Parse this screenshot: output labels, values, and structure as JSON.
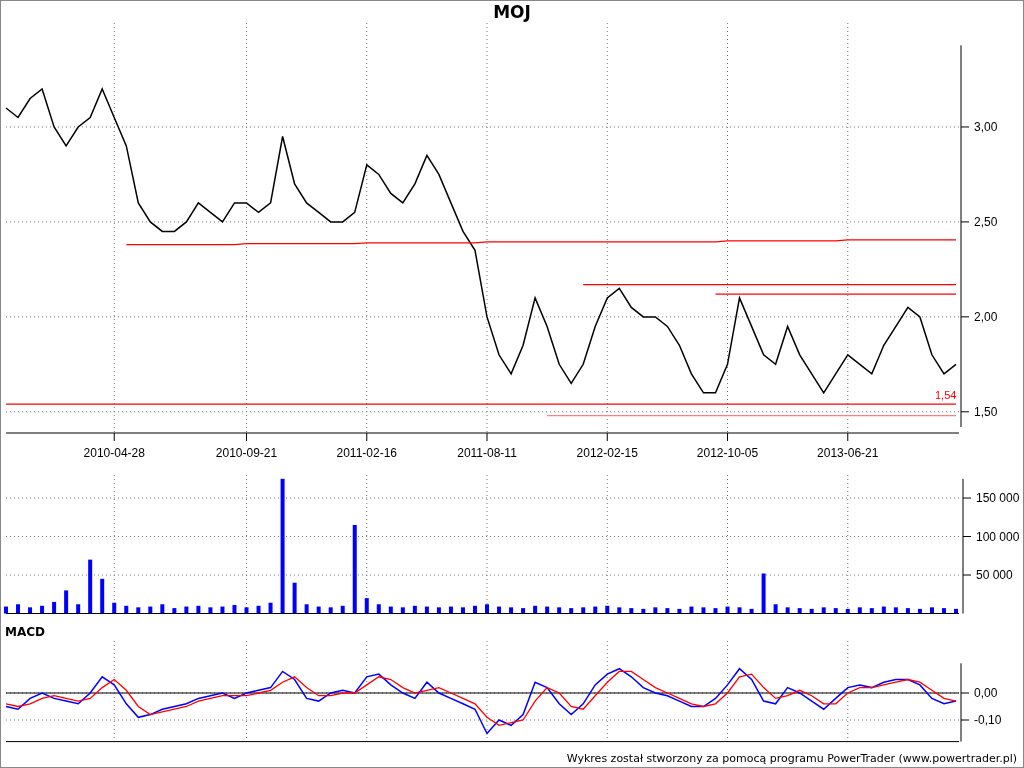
{
  "title": "MOJ",
  "price_chart": {
    "chart_data": {
      "type": "line",
      "grid": true,
      "categories": [
        null,
        null,
        null,
        null,
        null,
        null,
        null,
        null,
        null,
        "2010-04-28",
        null,
        null,
        null,
        null,
        null,
        null,
        null,
        null,
        null,
        null,
        "2010-09-21",
        null,
        null,
        null,
        null,
        null,
        null,
        null,
        null,
        null,
        "2011-02-16",
        null,
        null,
        null,
        null,
        null,
        null,
        null,
        null,
        null,
        "2011-08-11",
        null,
        null,
        null,
        null,
        null,
        null,
        null,
        null,
        null,
        "2012-02-15",
        null,
        null,
        null,
        null,
        null,
        null,
        null,
        null,
        null,
        "2012-10-05",
        null,
        null,
        null,
        null,
        null,
        null,
        null,
        null,
        null,
        "2013-06-21",
        null,
        null,
        null,
        null,
        null,
        null,
        null,
        null,
        null
      ],
      "ylim": [
        1.42,
        3.43
      ],
      "yticks": [
        {
          "value": 3.0,
          "label": "3,00"
        },
        {
          "value": 2.5,
          "label": "2,50"
        },
        {
          "value": 2.0,
          "label": "2,00"
        },
        {
          "value": 1.5,
          "label": "1,50"
        }
      ],
      "series": [
        {
          "color": "#000000",
          "values": [
            3.1,
            3.05,
            3.15,
            3.2,
            3.0,
            2.9,
            3.0,
            3.05,
            3.2,
            3.05,
            2.9,
            2.6,
            2.5,
            2.45,
            2.45,
            2.5,
            2.6,
            2.55,
            2.5,
            2.6,
            2.6,
            2.55,
            2.6,
            2.95,
            2.7,
            2.6,
            2.55,
            2.5,
            2.5,
            2.55,
            2.8,
            2.75,
            2.65,
            2.6,
            2.7,
            2.85,
            2.75,
            2.6,
            2.45,
            2.35,
            2.0,
            1.8,
            1.7,
            1.85,
            2.1,
            1.95,
            1.75,
            1.65,
            1.75,
            1.95,
            2.1,
            2.15,
            2.05,
            2.0,
            2.0,
            1.95,
            1.85,
            1.7,
            1.6,
            1.6,
            1.75,
            2.1,
            1.95,
            1.8,
            1.75,
            1.95,
            1.8,
            1.7,
            1.6,
            1.7,
            1.8,
            1.75,
            1.7,
            1.85,
            1.95,
            2.05,
            2.0,
            1.8,
            1.7,
            1.75
          ]
        },
        {
          "color": "#ff0000",
          "values": [
            null,
            null,
            null,
            null,
            null,
            null,
            null,
            null,
            null,
            null,
            2.38,
            2.38,
            2.38,
            2.38,
            2.38,
            2.38,
            2.38,
            2.38,
            2.38,
            2.38,
            2.385,
            2.385,
            2.385,
            2.385,
            2.385,
            2.385,
            2.385,
            2.385,
            2.385,
            2.385,
            2.39,
            2.39,
            2.39,
            2.39,
            2.39,
            2.39,
            2.39,
            2.39,
            2.39,
            2.39,
            2.395,
            2.395,
            2.395,
            2.395,
            2.395,
            2.395,
            2.395,
            2.395,
            2.395,
            2.395,
            2.395,
            2.395,
            2.395,
            2.395,
            2.395,
            2.395,
            2.395,
            2.395,
            2.395,
            2.395,
            2.4,
            2.4,
            2.4,
            2.4,
            2.4,
            2.4,
            2.4,
            2.4,
            2.4,
            2.4,
            2.405,
            2.405,
            2.405,
            2.405,
            2.405,
            2.405,
            2.405,
            2.405,
            2.405,
            2.405
          ]
        },
        {
          "color": "#ff0000",
          "values": [
            null,
            null,
            null,
            null,
            null,
            null,
            null,
            null,
            null,
            null,
            null,
            null,
            null,
            null,
            null,
            null,
            null,
            null,
            null,
            null,
            null,
            null,
            null,
            null,
            null,
            null,
            null,
            null,
            null,
            null,
            null,
            null,
            null,
            null,
            null,
            null,
            null,
            null,
            null,
            null,
            null,
            null,
            null,
            null,
            null,
            null,
            null,
            null,
            2.17,
            2.17,
            2.17,
            2.17,
            2.17,
            2.17,
            2.17,
            2.17,
            2.17,
            2.17,
            2.17,
            2.17,
            2.17,
            2.17,
            2.17,
            2.17,
            2.17,
            2.17,
            2.17,
            2.17,
            2.17,
            2.17,
            2.17,
            2.17,
            2.17,
            2.17,
            2.17,
            2.17,
            2.17,
            2.17,
            2.17,
            2.17
          ]
        },
        {
          "color": "#ff0000",
          "values": [
            null,
            null,
            null,
            null,
            null,
            null,
            null,
            null,
            null,
            null,
            null,
            null,
            null,
            null,
            null,
            null,
            null,
            null,
            null,
            null,
            null,
            null,
            null,
            null,
            null,
            null,
            null,
            null,
            null,
            null,
            null,
            null,
            null,
            null,
            null,
            null,
            null,
            null,
            null,
            null,
            null,
            null,
            null,
            null,
            null,
            null,
            null,
            null,
            null,
            null,
            null,
            null,
            null,
            null,
            null,
            null,
            null,
            null,
            null,
            2.12,
            2.12,
            2.12,
            2.12,
            2.12,
            2.12,
            2.12,
            2.12,
            2.12,
            2.12,
            2.12,
            2.12,
            2.12,
            2.12,
            2.12,
            2.12,
            2.12,
            2.12,
            2.12,
            2.12,
            2.12
          ]
        },
        {
          "color": "#ff0000",
          "values": [
            1.54,
            1.54,
            1.54,
            1.54,
            1.54,
            1.54,
            1.54,
            1.54,
            1.54,
            1.54,
            1.54,
            1.54,
            1.54,
            1.54,
            1.54,
            1.54,
            1.54,
            1.54,
            1.54,
            1.54,
            1.54,
            1.54,
            1.54,
            1.54,
            1.54,
            1.54,
            1.54,
            1.54,
            1.54,
            1.54,
            1.54,
            1.54,
            1.54,
            1.54,
            1.54,
            1.54,
            1.54,
            1.54,
            1.54,
            1.54,
            1.54,
            1.54,
            1.54,
            1.54,
            1.54,
            1.54,
            1.54,
            1.54,
            1.54,
            1.54,
            1.54,
            1.54,
            1.54,
            1.54,
            1.54,
            1.54,
            1.54,
            1.54,
            1.54,
            1.54,
            1.54,
            1.54,
            1.54,
            1.54,
            1.54,
            1.54,
            1.54,
            1.54,
            1.54,
            1.54,
            1.54,
            1.54,
            1.54,
            1.54,
            1.54,
            1.54,
            1.54,
            1.54,
            1.54,
            1.54
          ]
        },
        {
          "color": "#ff8080",
          "values": [
            null,
            null,
            null,
            null,
            null,
            null,
            null,
            null,
            null,
            null,
            null,
            null,
            null,
            null,
            null,
            null,
            null,
            null,
            null,
            null,
            null,
            null,
            null,
            null,
            null,
            null,
            null,
            null,
            null,
            null,
            null,
            null,
            null,
            null,
            null,
            null,
            null,
            null,
            null,
            null,
            null,
            null,
            null,
            null,
            null,
            1.48,
            1.48,
            1.48,
            1.48,
            1.48,
            1.48,
            1.48,
            1.48,
            1.48,
            1.48,
            1.48,
            1.48,
            1.48,
            1.48,
            1.48,
            1.48,
            1.48,
            1.48,
            1.48,
            1.48,
            1.48,
            1.48,
            1.48,
            1.48,
            1.48,
            1.48,
            1.48,
            1.48,
            1.48,
            1.48,
            1.48,
            1.48,
            1.48,
            1.48,
            1.48
          ]
        }
      ],
      "annotations": [
        "1,54"
      ]
    }
  },
  "volume_chart": {
    "chart_data": {
      "type": "bar",
      "grid": true,
      "categories": [
        null,
        null,
        null,
        null,
        null,
        null,
        null,
        null,
        null,
        null,
        null,
        null,
        null,
        null,
        null,
        null,
        null,
        null,
        null,
        null,
        null,
        null,
        null,
        null,
        null,
        null,
        null,
        null,
        null,
        null,
        null,
        null,
        null,
        null,
        null,
        null,
        null,
        null,
        null,
        null,
        null,
        null,
        null,
        null,
        null,
        null,
        null,
        null,
        null,
        null,
        null,
        null,
        null,
        null,
        null,
        null,
        null,
        null,
        null,
        null,
        null,
        null,
        null,
        null,
        null,
        null,
        null,
        null,
        null,
        null,
        null,
        null,
        null,
        null,
        null,
        null,
        null,
        null,
        null,
        null
      ],
      "ylim": [
        0,
        175000
      ],
      "yticks": [
        {
          "value": 150000,
          "label": "150 000"
        },
        {
          "value": 100000,
          "label": "100 000"
        },
        {
          "value": 50000,
          "label": "50 000"
        }
      ],
      "series": [
        {
          "color": "#0000ff",
          "values": [
            9000,
            12000,
            8000,
            10000,
            15000,
            30000,
            12000,
            70000,
            45000,
            14000,
            10000,
            8000,
            9000,
            12000,
            7000,
            9000,
            10000,
            8000,
            9000,
            11000,
            8000,
            10000,
            14000,
            175000,
            40000,
            12000,
            9000,
            8000,
            10000,
            115000,
            20000,
            12000,
            9000,
            8000,
            10000,
            9000,
            8000,
            9000,
            8000,
            10000,
            12000,
            9000,
            8000,
            7000,
            10000,
            9000,
            8000,
            7000,
            8000,
            9000,
            10000,
            8000,
            7000,
            6000,
            8000,
            7000,
            6000,
            9000,
            8000,
            7000,
            9000,
            8000,
            6000,
            52000,
            12000,
            8000,
            7000,
            6000,
            8000,
            7000,
            6000,
            8000,
            7000,
            9000,
            8000,
            7000,
            6000,
            8000,
            7000,
            6000
          ]
        }
      ]
    }
  },
  "macd_panel": {
    "label": "MACD",
    "chart_data": {
      "type": "line",
      "grid": true,
      "categories": [
        null,
        null,
        null,
        null,
        null,
        null,
        null,
        null,
        null,
        null,
        null,
        null,
        null,
        null,
        null,
        null,
        null,
        null,
        null,
        null,
        null,
        null,
        null,
        null,
        null,
        null,
        null,
        null,
        null,
        null,
        null,
        null,
        null,
        null,
        null,
        null,
        null,
        null,
        null,
        null,
        null,
        null,
        null,
        null,
        null,
        null,
        null,
        null,
        null,
        null,
        null,
        null,
        null,
        null,
        null,
        null,
        null,
        null,
        null,
        null,
        null,
        null,
        null,
        null,
        null,
        null,
        null,
        null,
        null,
        null,
        null,
        null,
        null,
        null,
        null,
        null,
        null,
        null,
        null,
        null
      ],
      "ylim": [
        -0.18,
        0.11
      ],
      "yticks": [
        {
          "value": 0,
          "label": "0,00"
        },
        {
          "value": -0.1,
          "label": "-0,10"
        }
      ],
      "series": [
        {
          "color": "#0000ff",
          "values": [
            -0.05,
            -0.06,
            -0.02,
            0.0,
            -0.02,
            -0.03,
            -0.04,
            0.0,
            0.06,
            0.03,
            -0.04,
            -0.09,
            -0.08,
            -0.06,
            -0.05,
            -0.04,
            -0.02,
            -0.01,
            0.0,
            -0.02,
            0.0,
            0.01,
            0.02,
            0.08,
            0.05,
            -0.02,
            -0.03,
            0.0,
            0.01,
            0.0,
            0.06,
            0.07,
            0.03,
            0.0,
            -0.02,
            0.04,
            0.0,
            -0.02,
            -0.04,
            -0.06,
            -0.15,
            -0.1,
            -0.12,
            -0.08,
            0.04,
            0.02,
            -0.04,
            -0.08,
            -0.04,
            0.03,
            0.07,
            0.09,
            0.06,
            0.02,
            0.0,
            -0.01,
            -0.03,
            -0.05,
            -0.05,
            -0.02,
            0.03,
            0.09,
            0.05,
            -0.03,
            -0.04,
            0.02,
            0.0,
            -0.03,
            -0.06,
            -0.02,
            0.02,
            0.03,
            0.02,
            0.04,
            0.05,
            0.05,
            0.03,
            -0.02,
            -0.04,
            -0.03
          ]
        },
        {
          "color": "#ff0000",
          "values": [
            -0.04,
            -0.05,
            -0.04,
            -0.02,
            -0.01,
            -0.02,
            -0.03,
            -0.02,
            0.02,
            0.05,
            0.01,
            -0.05,
            -0.08,
            -0.07,
            -0.06,
            -0.05,
            -0.03,
            -0.02,
            -0.01,
            -0.01,
            -0.01,
            0.0,
            0.01,
            0.04,
            0.06,
            0.02,
            -0.01,
            -0.01,
            0.0,
            0.0,
            0.03,
            0.06,
            0.05,
            0.02,
            0.0,
            0.01,
            0.02,
            0.0,
            -0.02,
            -0.04,
            -0.09,
            -0.12,
            -0.11,
            -0.1,
            -0.03,
            0.02,
            0.0,
            -0.05,
            -0.06,
            -0.01,
            0.04,
            0.08,
            0.08,
            0.05,
            0.02,
            0.0,
            -0.02,
            -0.04,
            -0.05,
            -0.04,
            0.0,
            0.06,
            0.07,
            0.02,
            -0.02,
            -0.01,
            0.01,
            -0.01,
            -0.04,
            -0.04,
            0.0,
            0.02,
            0.02,
            0.03,
            0.04,
            0.05,
            0.04,
            0.01,
            -0.02,
            -0.03
          ]
        }
      ]
    }
  },
  "footer": "Wykres został stworzony za pomocą programu PowerTrader (www.powertrader.pl)"
}
